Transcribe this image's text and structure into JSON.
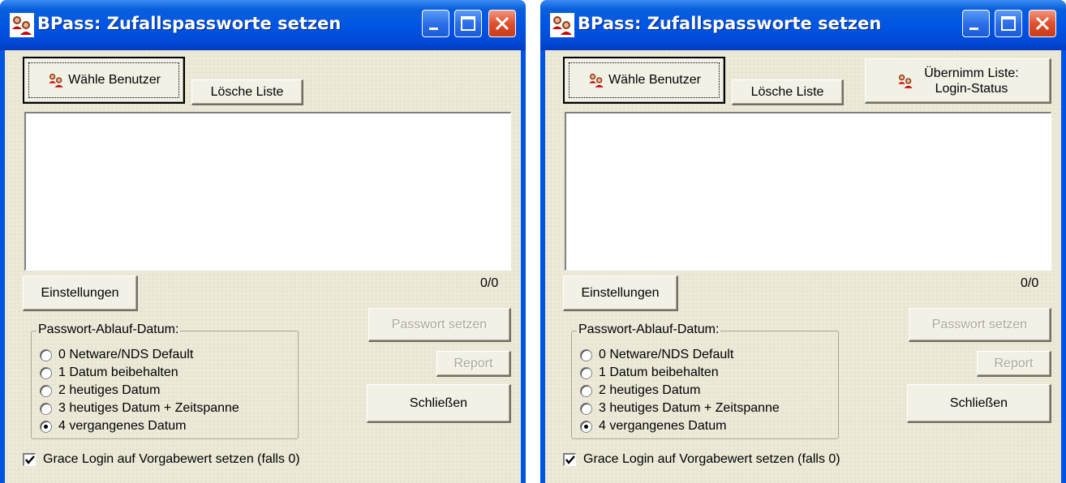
{
  "windows": [
    {
      "title": "BPass: Zufallspassworte setzen",
      "buttons": {
        "select_users": "Wähle Benutzer",
        "clear_list": "Lösche Liste",
        "settings": "Einstellungen",
        "set_password": "Passwort setzen",
        "report": "Report",
        "close": "Schließen"
      },
      "counter": "0/0",
      "group_title": "Passwort-Ablauf-Datum:",
      "radio_options": [
        {
          "label": "0 Netware/NDS Default",
          "checked": false
        },
        {
          "label": "1 Datum beibehalten",
          "checked": false
        },
        {
          "label": "2 heutiges Datum",
          "checked": false
        },
        {
          "label": "3 heutiges Datum + Zeitspanne",
          "checked": false
        },
        {
          "label": "4 vergangenes Datum",
          "checked": true
        }
      ],
      "checkbox_label": "Grace Login auf Vorgabewert setzen (falls 0)",
      "checkbox_checked": true
    },
    {
      "title": "BPass: Zufallspassworte setzen",
      "buttons": {
        "select_users": "Wähle Benutzer",
        "clear_list": "Lösche Liste",
        "take_list_line1": "Übernimm Liste:",
        "take_list_line2": "Login-Status",
        "settings": "Einstellungen",
        "set_password": "Passwort setzen",
        "report": "Report",
        "close": "Schließen"
      },
      "counter": "0/0",
      "group_title": "Passwort-Ablauf-Datum:",
      "radio_options": [
        {
          "label": "0 Netware/NDS Default",
          "checked": false
        },
        {
          "label": "1 Datum beibehalten",
          "checked": false
        },
        {
          "label": "2 heutiges Datum",
          "checked": false
        },
        {
          "label": "3 heutiges Datum + Zeitspanne",
          "checked": false
        },
        {
          "label": "4 vergangenes Datum",
          "checked": true
        }
      ],
      "checkbox_label": "Grace Login auf Vorgabewert setzen (falls 0)",
      "checkbox_checked": true
    }
  ],
  "icons": {
    "app": "users-icon",
    "minimize": "minimize-icon",
    "maximize": "maximize-icon",
    "close": "close-icon",
    "checkmark": "checkmark-icon"
  },
  "colors": {
    "titlebar": "#0055e5",
    "dialog_bg": "#ece9d8",
    "close_button": "#e0512d"
  }
}
